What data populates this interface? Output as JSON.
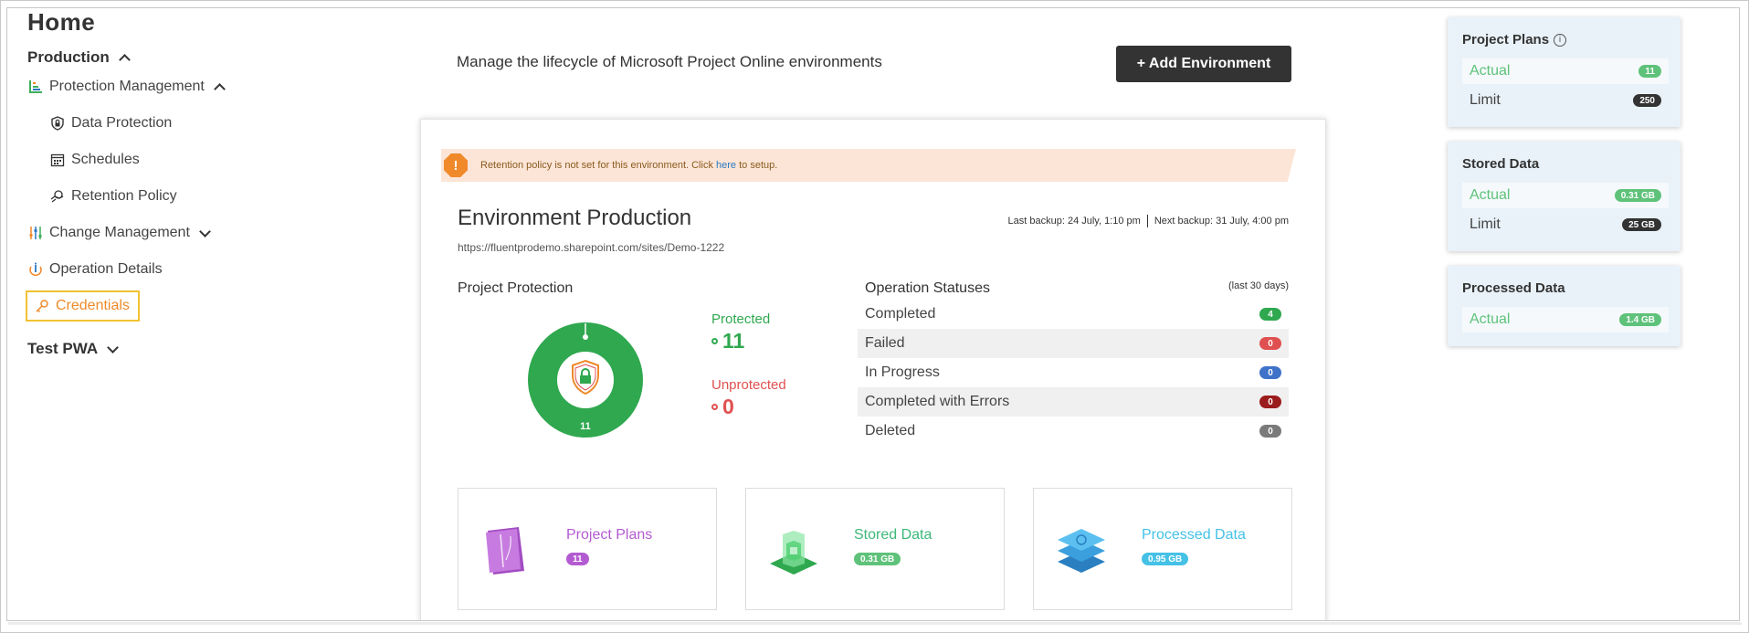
{
  "page": {
    "title": "Home"
  },
  "sidebar": {
    "production": "Production",
    "protection_management": "Protection Management",
    "data_protection": "Data Protection",
    "schedules": "Schedules",
    "retention_policy": "Retention Policy",
    "change_management": "Change Management",
    "operation_details": "Operation Details",
    "credentials": "Credentials",
    "test_pwa": "Test PWA"
  },
  "main": {
    "subtitle": "Manage the lifecycle of Microsoft Project Online environments",
    "add_button": "+ Add Environment",
    "banner": {
      "text_before": "Retention policy is not set for this environment. Click ",
      "link": "here",
      "text_after": " to setup.",
      "icon": "!"
    },
    "env_title": "Environment Production",
    "env_url": "https://fluentprodemo.sharepoint.com/sites/Demo-1222",
    "last_backup": "Last backup: 24 July, 1:10 pm",
    "next_backup": "Next backup: 31 July, 4:00 pm",
    "protection": {
      "title": "Project Protection",
      "protected_label": "Protected",
      "protected_value": "11",
      "unprotected_label": "Unprotected",
      "unprotected_value": "0",
      "donut_total": "11"
    },
    "operations": {
      "title": "Operation Statuses",
      "period": "(last 30 days)",
      "rows": [
        {
          "label": "Completed",
          "count": "4",
          "color": "#2fa84f"
        },
        {
          "label": "Failed",
          "count": "0",
          "color": "#e05050"
        },
        {
          "label": "In Progress",
          "count": "0",
          "color": "#3f72c8"
        },
        {
          "label": "Completed with Errors",
          "count": "0",
          "color": "#9b1c1c"
        },
        {
          "label": "Deleted",
          "count": "0",
          "color": "#7a7a7a"
        }
      ]
    },
    "stats": {
      "project_plans": {
        "label": "Project Plans",
        "value": "11"
      },
      "stored_data": {
        "label": "Stored Data",
        "value": "0.31 GB"
      },
      "processed_data": {
        "label": "Processed Data",
        "value": "0.95 GB"
      }
    }
  },
  "right_panels": {
    "project_plans": {
      "title": "Project Plans",
      "actual_label": "Actual",
      "actual": "11",
      "limit_label": "Limit",
      "limit": "250"
    },
    "stored_data": {
      "title": "Stored Data",
      "actual_label": "Actual",
      "actual": "0.31 GB",
      "limit_label": "Limit",
      "limit": "25 GB"
    },
    "processed_data": {
      "title": "Processed Data",
      "actual_label": "Actual",
      "actual": "1.4 GB"
    }
  },
  "colors": {
    "green": "#2fa84f",
    "red": "#e05050",
    "orange": "#ee8a2a",
    "purple": "#b35bd1",
    "teal_green": "#3cb878",
    "cyan": "#45c1e6",
    "actual_green": "#5fc27a",
    "dark": "#333333"
  },
  "icons": {
    "protection_management": "bar-chart-icon",
    "data_protection": "lock-shield-icon",
    "schedules": "calendar-icon",
    "retention_policy": "hand-coin-icon",
    "change_management": "sliders-icon",
    "operation_details": "info-drop-icon",
    "credentials": "key-icon"
  }
}
